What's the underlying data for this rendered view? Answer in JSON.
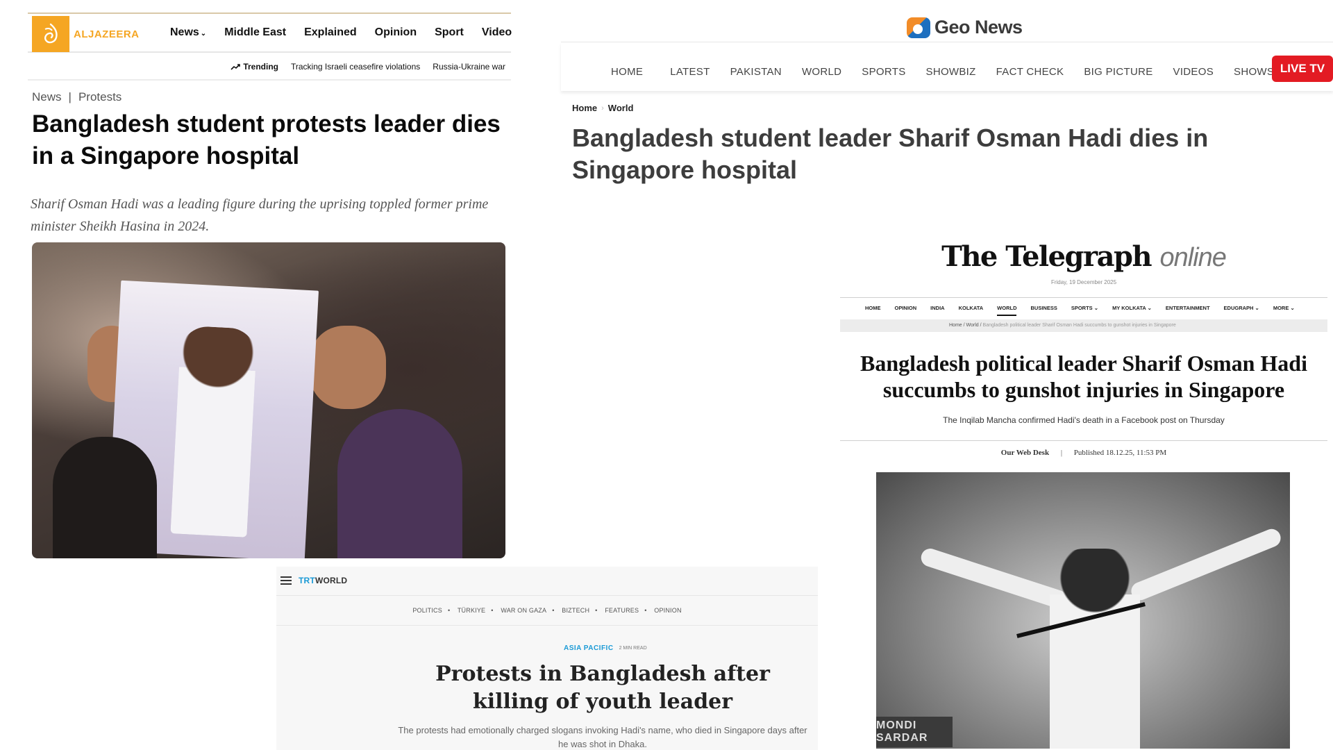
{
  "aljazeera": {
    "logo_text": "ALJAZEERA",
    "nav": [
      "News",
      "Middle East",
      "Explained",
      "Opinion",
      "Sport",
      "Video"
    ],
    "trending_label": "Trending",
    "trending_items": [
      "Tracking Israeli ceasefire violations",
      "Russia-Ukraine war"
    ],
    "breadcrumb": [
      "News",
      "Protests"
    ],
    "breadcrumb_sep": "|",
    "headline": "Bangladesh student protests leader dies in a Singapore hospital",
    "standfirst": "Sharif Osman Hadi was a leading figure during the uprising toppled former prime minister Sheikh Hasina in 2024.",
    "accent": "#f5a623"
  },
  "geo": {
    "logo_text": "Geo News",
    "nav": [
      "HOME",
      "LATEST",
      "PAKISTAN",
      "WORLD",
      "SPORTS",
      "SHOWBIZ",
      "FACT CHECK",
      "BIG PICTURE",
      "VIDEOS",
      "SHOWS"
    ],
    "live_label": "LIVE TV",
    "breadcrumb": [
      "Home",
      "World"
    ],
    "headline": "Bangladesh student leader Sharif Osman Hadi dies in Singapore hospital",
    "live_color": "#e31b23"
  },
  "telegraph": {
    "masthead": "The Telegraph",
    "masthead_suffix": "online",
    "date": "Friday, 19 December 2025",
    "nav": [
      "HOME",
      "OPINION",
      "INDIA",
      "KOLKATA",
      "WORLD",
      "BUSINESS",
      "SPORTS",
      "MY KOLKATA",
      "ENTERTAINMENT",
      "EDUGRAPH",
      "MORE"
    ],
    "breadcrumb": [
      "Home",
      "World"
    ],
    "breadcrumb_current": "Bangladesh political leader Sharif Osman Hadi succumbs to gunshot injuries in Singapore",
    "headline": "Bangladesh political leader Sharif Osman Hadi succumbs to gunshot injuries in Singapore",
    "standfirst": "The Inqilab Mancha confirmed Hadi's death in a Facebook post on Thursday",
    "byline": "Our Web Desk",
    "published": "Published 18.12.25, 11:53 PM",
    "image_sign": "MONDI SARDAR"
  },
  "trt": {
    "logo_a": "TRT",
    "logo_b": "WORLD",
    "nav": [
      "POLITICS",
      "TÜRKIYE",
      "WAR ON GAZA",
      "BIZTECH",
      "FEATURES",
      "OPINION"
    ],
    "section": "ASIA PACIFIC",
    "read_time": "2 MIN READ",
    "headline": "Protests in Bangladesh after killing of youth leader",
    "standfirst": "The protests had emotionally charged slogans invoking Hadi's name, who died in Singapore days after he was shot in Dhaka.",
    "accent": "#1a9ad6"
  }
}
